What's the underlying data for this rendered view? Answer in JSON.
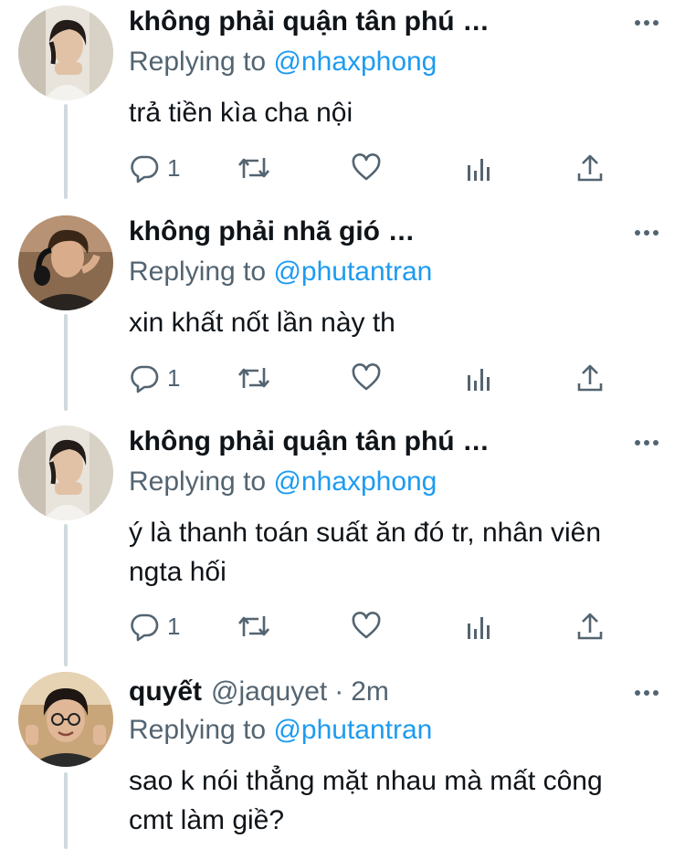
{
  "tweets": [
    {
      "name": "không phải quận tân phú",
      "ellipsis": "...",
      "handle": "",
      "separator": "",
      "time": "",
      "replying_prefix": "Replying to",
      "replying_handle": "@nhaxphong",
      "text": "trả tiền kìa cha nội",
      "reply_count": "1"
    },
    {
      "name": "không phải nhã gió",
      "ellipsis": "...",
      "handle": "",
      "separator": "",
      "time": "",
      "replying_prefix": "Replying to",
      "replying_handle": "@phutantran",
      "text": "xin khất nốt lần này th",
      "reply_count": "1"
    },
    {
      "name": "không phải quận tân phú",
      "ellipsis": "...",
      "handle": "",
      "separator": "",
      "time": "",
      "replying_prefix": "Replying to",
      "replying_handle": "@nhaxphong",
      "text": "ý là thanh toán suất ăn đó tr, nhân viên ngta hối",
      "reply_count": "1"
    },
    {
      "name": "quyết",
      "ellipsis": "",
      "handle": "@jaquyet",
      "separator": "·",
      "time": "2m",
      "replying_prefix": "Replying to",
      "replying_handle": "@phutantran",
      "text": "sao k nói thẳng mặt nhau mà mất công cmt làm giề?",
      "reply_count": ""
    }
  ],
  "icons": {
    "more": "more-horizontal-icon",
    "reply": "reply-bubble-icon",
    "retweet": "retweet-icon",
    "like": "heart-icon",
    "analytics": "analytics-bars-icon",
    "share": "share-upload-icon"
  },
  "colors": {
    "text": "#0f1419",
    "muted": "#536471",
    "link": "#1d9bf0",
    "thread_line": "#cfd9de",
    "background": "#ffffff"
  }
}
